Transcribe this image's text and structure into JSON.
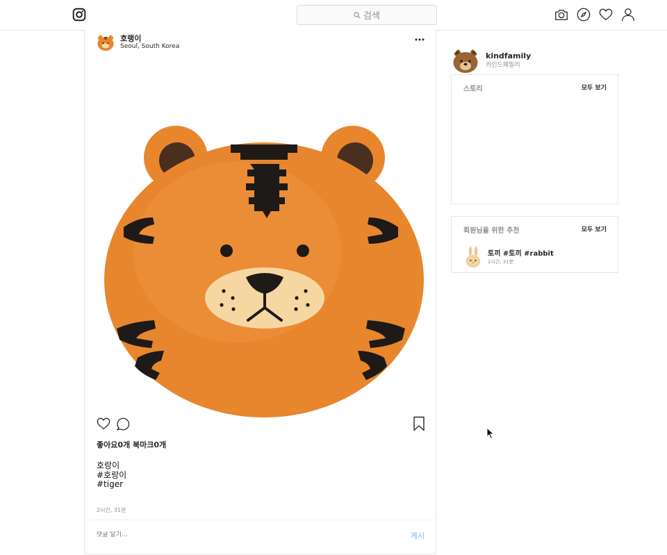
{
  "header": {
    "search_placeholder": "검색",
    "icons": [
      "instagram-logo-icon",
      "search-icon",
      "camera-icon",
      "compass-icon",
      "heart-icon",
      "user-icon"
    ]
  },
  "post": {
    "username": "호랭이",
    "location": "Seoul, South Korea",
    "counts": "좋아요0개 북마크0개",
    "caption_lines": [
      "호랑이",
      "#호랑이",
      "#tiger"
    ],
    "time": "2시간, 31분",
    "comment_placeholder": "댓글 달기...",
    "post_button": "게시",
    "colors": {
      "accent": "#7fb2e5",
      "tiger_fur": "#e8862e",
      "tiger_stripe": "#1e1a17"
    }
  },
  "sidebar": {
    "profile": {
      "username": "kindfamily",
      "subtitle": "카인드패밀리"
    },
    "stories": {
      "title": "스토리",
      "see_all": "모두 보기"
    },
    "recommendations": {
      "title": "회원님을 위한 추천",
      "see_all": "모두 보기",
      "items": [
        {
          "name": "토끼 #토끼 #rabbit",
          "time": "2시간, 31분"
        }
      ]
    }
  }
}
